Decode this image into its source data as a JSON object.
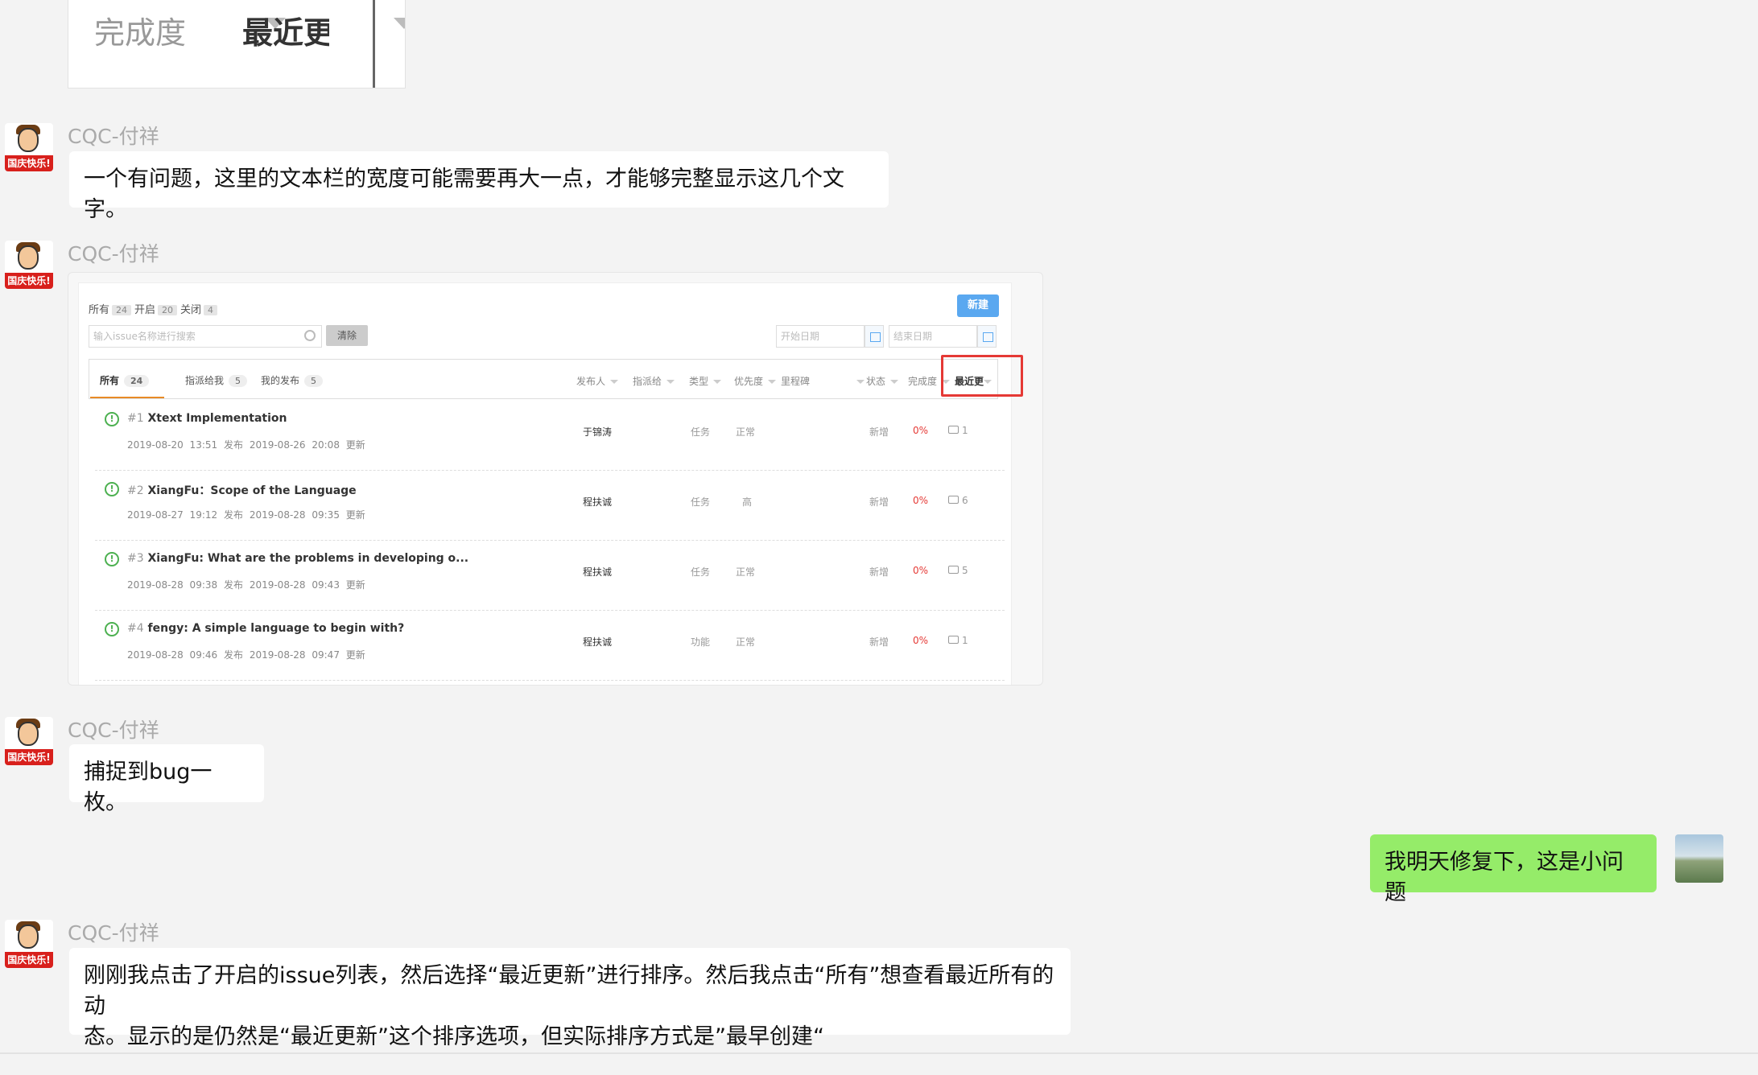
{
  "cropped_header": {
    "col1": "完成度",
    "col2": "最近更新"
  },
  "messages": [
    {
      "sender": "CQC-付祥",
      "text": "一个有问题，这里的文本栏的宽度可能需要再大一点，才能够完整显示这几个文字。"
    },
    {
      "sender": "CQC-付祥"
    },
    {
      "sender": "CQC-付祥",
      "text": "捕捉到bug一枚。"
    },
    {
      "sender": "me",
      "text": "我明天修复下，这是小问题"
    },
    {
      "sender": "CQC-付祥",
      "line1": "刚刚我点击了开启的issue列表，然后选择“最近更新”进行排序。然后我点击“所有”想查看最近所有的动",
      "line2": "态。显示的是仍然是“最近更新”这个排序选项，但实际排序方式是”最早创建“"
    }
  ],
  "avatar_banner": "国庆快乐!",
  "screenshot": {
    "status": {
      "all": "所有",
      "all_count": "24",
      "open": "开启",
      "open_count": "20",
      "closed": "关闭",
      "closed_count": "4"
    },
    "new_button": "新建",
    "search_placeholder": "输入issue名称进行搜索",
    "clear_button": "清除",
    "start_date": "开始日期",
    "end_date": "结束日期",
    "tabs": [
      {
        "label": "所有",
        "count": "24"
      },
      {
        "label": "指派给我",
        "count": "5"
      },
      {
        "label": "我的发布",
        "count": "5"
      }
    ],
    "filters": [
      "发布人",
      "指派给",
      "类型",
      "优先度",
      "里程碑",
      "状态",
      "完成度",
      "最近更"
    ],
    "issues": [
      {
        "no": "#1",
        "title": "Xtext Implementation",
        "created": "2019-08-20 13:51",
        "created_label": "发布",
        "updated": "2019-08-26 20:08",
        "updated_label": "更新",
        "assignee": "于锦涛",
        "type": "任务",
        "priority": "正常",
        "status": "新增",
        "progress": "0%",
        "comments": "1"
      },
      {
        "no": "#2",
        "title": "XiangFu：Scope of the Language",
        "created": "2019-08-27 19:12",
        "created_label": "发布",
        "updated": "2019-08-28 09:35",
        "updated_label": "更新",
        "assignee": "程扶诚",
        "type": "任务",
        "priority": "高",
        "status": "新增",
        "progress": "0%",
        "comments": "6"
      },
      {
        "no": "#3",
        "title": "XiangFu: What are the problems in developing o...",
        "created": "2019-08-28 09:38",
        "created_label": "发布",
        "updated": "2019-08-28 09:43",
        "updated_label": "更新",
        "assignee": "程扶诚",
        "type": "任务",
        "priority": "正常",
        "status": "新增",
        "progress": "0%",
        "comments": "5"
      },
      {
        "no": "#4",
        "title": "fengy: A simple language to begin with?",
        "created": "2019-08-28 09:46",
        "created_label": "发布",
        "updated": "2019-08-28 09:47",
        "updated_label": "更新",
        "assignee": "程扶诚",
        "type": "功能",
        "priority": "正常",
        "status": "新增",
        "progress": "0%",
        "comments": "1"
      }
    ]
  }
}
